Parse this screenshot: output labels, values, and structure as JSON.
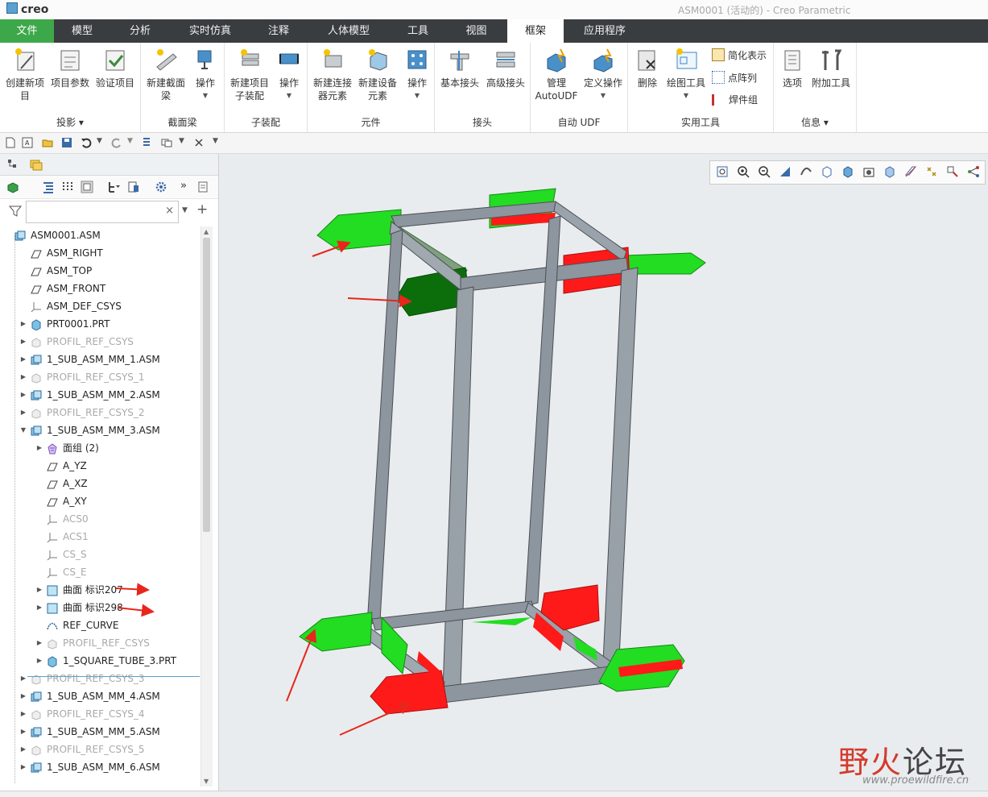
{
  "app": {
    "logo": "creo",
    "window_title": "ASM0001 (活动的) - Creo Parametric"
  },
  "menu": {
    "tabs": [
      {
        "label": "文件"
      },
      {
        "label": "模型"
      },
      {
        "label": "分析"
      },
      {
        "label": "实时仿真"
      },
      {
        "label": "注释"
      },
      {
        "label": "人体模型"
      },
      {
        "label": "工具"
      },
      {
        "label": "视图"
      },
      {
        "label": "框架"
      },
      {
        "label": "应用程序"
      }
    ],
    "active_tab": "框架",
    "colors": {
      "menubar": "#3a3d40",
      "file_tab": "#3da84a"
    }
  },
  "ribbon": {
    "groups": {
      "projection": "投影",
      "beam": "截面梁",
      "subassembly": "子装配",
      "component": "元件",
      "joint": "接头",
      "auto_udf": "自动 UDF",
      "utility": "实用工具",
      "info": "信息"
    },
    "buttons": {
      "create_project": "创建新项目",
      "project_params": "项目参数",
      "verify_project": "验证项目",
      "new_section_beam": "新建截面梁",
      "operation": "操作",
      "new_project_subasm": "新建项目子装配",
      "new_connector": "新建连接器元素",
      "new_equipment": "新建设备元素",
      "basic_joint": "基本接头",
      "advanced_joint": "高级接头",
      "manage_autoudf": "管理 AutoUDF",
      "define_operation": "定义操作",
      "delete": "删除",
      "drawing_tools": "绘图工具",
      "simplified_rep": "简化表示",
      "point_array": "点阵列",
      "weld_group": "焊件组",
      "options": "选项",
      "add_tools": "附加工具"
    }
  },
  "tree": {
    "search_placeholder": "",
    "items": [
      {
        "label": "ASM0001.ASM",
        "icon": "assembly-icon",
        "dim": false
      },
      {
        "label": "ASM_RIGHT",
        "icon": "datum-plane-icon",
        "dim": false
      },
      {
        "label": "ASM_TOP",
        "icon": "datum-plane-icon",
        "dim": false
      },
      {
        "label": "ASM_FRONT",
        "icon": "datum-plane-icon",
        "dim": false
      },
      {
        "label": "ASM_DEF_CSYS",
        "icon": "csys-icon",
        "dim": false
      },
      {
        "label": "PRT0001.PRT",
        "icon": "part-icon",
        "dim": false
      },
      {
        "label": "PROFIL_REF_CSYS",
        "icon": "suppressed-part-icon",
        "dim": true
      },
      {
        "label": "1_SUB_ASM_MM_1.ASM",
        "icon": "assembly-icon",
        "dim": false
      },
      {
        "label": "PROFIL_REF_CSYS_1",
        "icon": "suppressed-part-icon",
        "dim": true
      },
      {
        "label": "1_SUB_ASM_MM_2.ASM",
        "icon": "assembly-icon",
        "dim": false
      },
      {
        "label": "PROFIL_REF_CSYS_2",
        "icon": "suppressed-part-icon",
        "dim": true
      },
      {
        "label": "1_SUB_ASM_MM_3.ASM",
        "icon": "assembly-icon",
        "dim": false
      },
      {
        "label": "面组 (2)",
        "icon": "quilt-icon",
        "dim": false
      },
      {
        "label": "A_YZ",
        "icon": "datum-plane-icon",
        "dim": false
      },
      {
        "label": "A_XZ",
        "icon": "datum-plane-icon",
        "dim": false
      },
      {
        "label": "A_XY",
        "icon": "datum-plane-icon",
        "dim": false
      },
      {
        "label": "ACS0",
        "icon": "csys-icon",
        "dim": true
      },
      {
        "label": "ACS1",
        "icon": "csys-icon",
        "dim": true
      },
      {
        "label": "CS_S",
        "icon": "csys-icon",
        "dim": true
      },
      {
        "label": "CS_E",
        "icon": "csys-icon",
        "dim": true
      },
      {
        "label": "曲面 标识207",
        "icon": "surface-icon",
        "dim": false
      },
      {
        "label": "曲面 标识298",
        "icon": "surface-icon",
        "dim": false
      },
      {
        "label": "REF_CURVE",
        "icon": "curve-icon",
        "dim": false
      },
      {
        "label": "PROFIL_REF_CSYS",
        "icon": "suppressed-part-icon",
        "dim": true
      },
      {
        "label": "1_SQUARE_TUBE_3.PRT",
        "icon": "part-icon",
        "dim": false
      },
      {
        "label": "PROFIL_REF_CSYS_3",
        "icon": "suppressed-part-icon",
        "dim": true
      },
      {
        "label": "1_SUB_ASM_MM_4.ASM",
        "icon": "assembly-icon",
        "dim": false
      },
      {
        "label": "PROFIL_REF_CSYS_4",
        "icon": "suppressed-part-icon",
        "dim": true
      },
      {
        "label": "1_SUB_ASM_MM_5.ASM",
        "icon": "assembly-icon",
        "dim": false
      },
      {
        "label": "PROFIL_REF_CSYS_5",
        "icon": "suppressed-part-icon",
        "dim": true
      },
      {
        "label": "1_SUB_ASM_MM_6.ASM",
        "icon": "assembly-icon",
        "dim": false
      }
    ]
  },
  "watermark": {
    "title_a": "野火",
    "title_b": "论坛",
    "url": "www.proewildfire.cn"
  },
  "colors": {
    "frame": "#8d959e",
    "surface_green": "#22dd22",
    "surface_red": "#ff1a1a",
    "dark_green": "#0b6e0b",
    "arrow": "#e8261c"
  }
}
